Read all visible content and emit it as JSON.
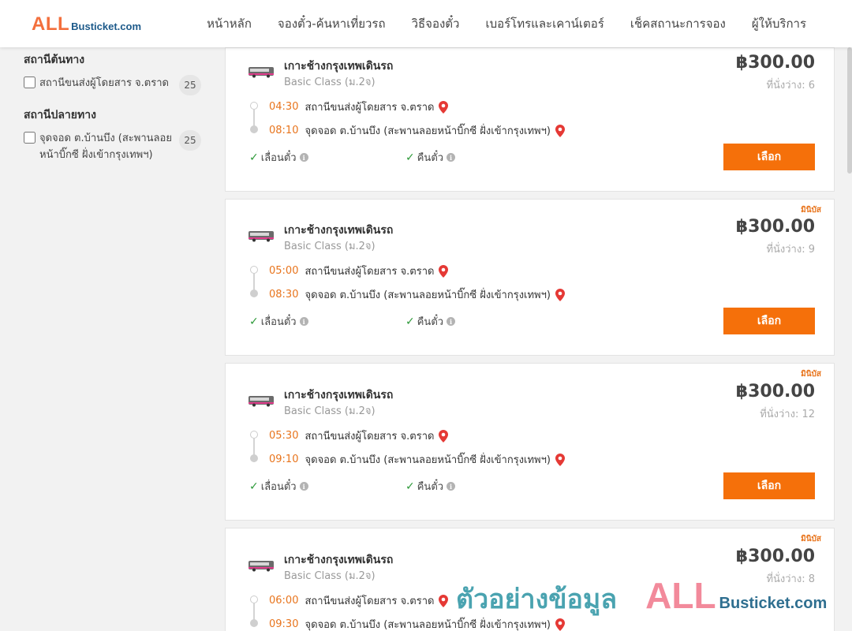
{
  "header": {
    "logo_all": "ALL",
    "logo_rest": "Busticket.com",
    "nav": [
      "หน้าหลัก",
      "จองตั๋ว-ค้นหาเที่ยวรถ",
      "วิธีจองตั๋ว",
      "เบอร์โทรและเคาน์เตอร์",
      "เช็คสถานะการจอง",
      "ผู้ให้บริการ"
    ]
  },
  "sidebar": {
    "origin_title": "สถานีต้นทาง",
    "origin_label": "สถานีขนส่งผู้โดยสาร จ.ตราด",
    "origin_count": "25",
    "dest_title": "สถานีปลายทาง",
    "dest_label": "จุดจอด ต.บ้านบึง (สะพานลอยหน้าบิ๊กซี ฝั่งเข้ากรุงเทพฯ)",
    "dest_count": "25"
  },
  "trips": [
    {
      "operator": "เกาะช้างกรุงเทพเดินรถ",
      "class": "Basic Class (ม.2จ)",
      "price": "฿300.00",
      "seats": "ที่นั่งว่าง: 6",
      "badge": "",
      "depart_time": "04:30",
      "depart_station": "สถานีขนส่งผู้โดยสาร จ.ตราด",
      "arrive_time": "08:10",
      "arrive_station": "จุดจอด ต.บ้านบึง (สะพานลอยหน้าบิ๊กซี ฝั่งเข้ากรุงเทพฯ)",
      "policy_change": "เลื่อนตั๋ว",
      "policy_refund": "คืนตั๋ว",
      "button": "เลือก"
    },
    {
      "operator": "เกาะช้างกรุงเทพเดินรถ",
      "class": "Basic Class (ม.2จ)",
      "price": "฿300.00",
      "seats": "ที่นั่งว่าง: 9",
      "badge": "มินิบัส",
      "depart_time": "05:00",
      "depart_station": "สถานีขนส่งผู้โดยสาร จ.ตราด",
      "arrive_time": "08:30",
      "arrive_station": "จุดจอด ต.บ้านบึง (สะพานลอยหน้าบิ๊กซี ฝั่งเข้ากรุงเทพฯ)",
      "policy_change": "เลื่อนตั๋ว",
      "policy_refund": "คืนตั๋ว",
      "button": "เลือก"
    },
    {
      "operator": "เกาะช้างกรุงเทพเดินรถ",
      "class": "Basic Class (ม.2จ)",
      "price": "฿300.00",
      "seats": "ที่นั่งว่าง: 12",
      "badge": "มินิบัส",
      "depart_time": "05:30",
      "depart_station": "สถานีขนส่งผู้โดยสาร จ.ตราด",
      "arrive_time": "09:10",
      "arrive_station": "จุดจอด ต.บ้านบึง (สะพานลอยหน้าบิ๊กซี ฝั่งเข้ากรุงเทพฯ)",
      "policy_change": "เลื่อนตั๋ว",
      "policy_refund": "คืนตั๋ว",
      "button": "เลือก"
    },
    {
      "operator": "เกาะช้างกรุงเทพเดินรถ",
      "class": "Basic Class (ม.2จ)",
      "price": "฿300.00",
      "seats": "ที่นั่งว่าง: 8",
      "badge": "มินิบัส",
      "depart_time": "06:00",
      "depart_station": "สถานีขนส่งผู้โดยสาร จ.ตราด",
      "arrive_time": "09:30",
      "arrive_station": "จุดจอด ต.บ้านบึง (สะพานลอยหน้าบิ๊กซี ฝั่งเข้ากรุงเทพฯ)"
    }
  ],
  "watermark": {
    "thai": "ตัวอย่างข้อมูล",
    "all": "ALL",
    "rest": "Busticket.com"
  },
  "colors": {
    "accent": "#f5700a",
    "time": "#e8741c",
    "check": "#2e9a3a",
    "pin": "#e53935"
  },
  "icons": [
    "bus-logo-icon",
    "location-pin-icon",
    "check-icon",
    "info-icon"
  ]
}
